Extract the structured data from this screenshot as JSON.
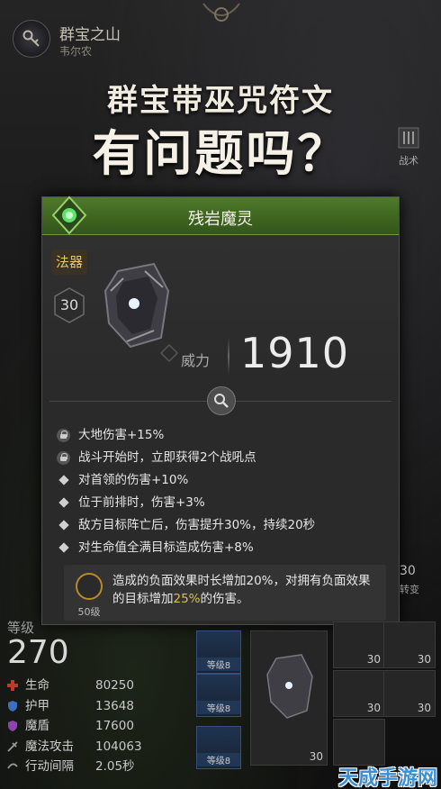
{
  "header": {
    "location_title": "群宝之山",
    "location_subtitle": "韦尔农"
  },
  "headline": {
    "line1": "群宝带巫咒符文",
    "line2": "有问题吗？"
  },
  "tactics_button": {
    "label": "战术"
  },
  "item": {
    "name": "残岩魔灵",
    "type_badge": "法器",
    "level": "30",
    "power_label": "威力",
    "power_value": "1910",
    "attributes": [
      {
        "kind": "locked",
        "text": "大地伤害+15%"
      },
      {
        "kind": "locked",
        "text": "战斗开始时，立即获得2个战吼点"
      },
      {
        "kind": "bullet",
        "text": "对首领的伤害+10%"
      },
      {
        "kind": "bullet",
        "text": "位于前排时，伤害+3%"
      },
      {
        "kind": "bullet",
        "text": "敌方目标阵亡后，伤害提升30%，持续20秒"
      },
      {
        "kind": "bullet",
        "text": "对生命值全满目标造成伤害+8%"
      }
    ],
    "set_bonus": {
      "level_label": "50级",
      "text_before": "造成的负面效果时长增加20%，对拥有负面效果的目标增加",
      "highlight": "25%",
      "text_after": "的伤害。"
    }
  },
  "hero": {
    "level_label": "等级",
    "level_value": "270",
    "stats": [
      {
        "name": "生命",
        "value": "80250",
        "icon": "cross-icon",
        "color": "#c0392b"
      },
      {
        "name": "护甲",
        "value": "13648",
        "icon": "shield-icon",
        "color": "#3b6fbf"
      },
      {
        "name": "魔盾",
        "value": "17600",
        "icon": "magic-shield-icon",
        "color": "#8e44ad"
      },
      {
        "name": "魔法攻击",
        "value": "104063",
        "icon": "magic-attack-icon",
        "color": "#888888"
      },
      {
        "name": "行动间隔",
        "value": "2.05秒",
        "icon": "speed-icon",
        "color": "#888888"
      }
    ]
  },
  "equipment": {
    "rune_slots": [
      {
        "label": "等级8"
      },
      {
        "label": "等级8"
      },
      {
        "label": "等级8"
      }
    ],
    "big_slot_level": "30",
    "gear_slots": [
      {
        "level": "30"
      },
      {
        "level": "30"
      },
      {
        "level": "30"
      },
      {
        "level": "30"
      }
    ],
    "side_level": "30",
    "side_text": "转变"
  },
  "watermark": "天成手游网"
}
